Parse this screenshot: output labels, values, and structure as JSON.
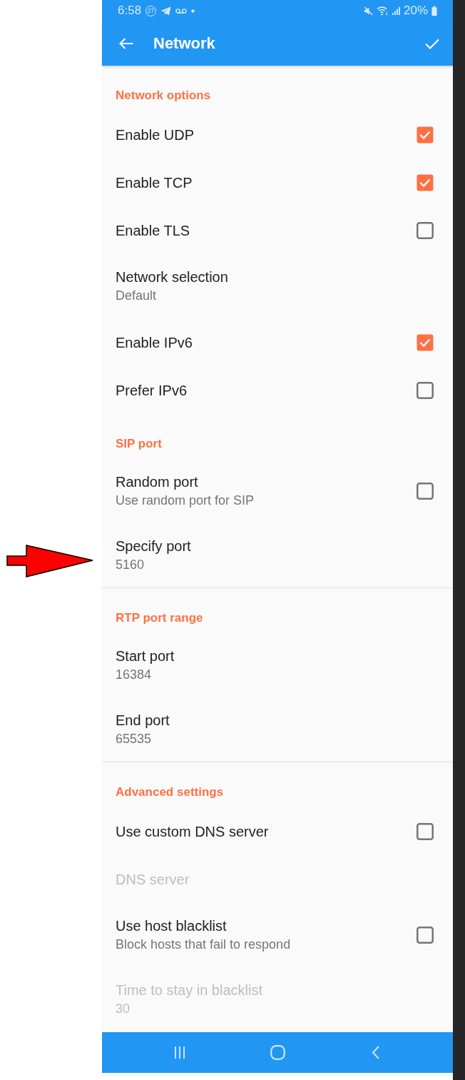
{
  "status_bar": {
    "time": "6:58",
    "notification_count": "27",
    "battery": "20%"
  },
  "app_bar": {
    "title": "Network"
  },
  "sections": [
    {
      "title": "Network options",
      "divider": false,
      "items": [
        {
          "kind": "checkbox",
          "title": "Enable UDP",
          "checked": true,
          "disabled": false
        },
        {
          "kind": "checkbox",
          "title": "Enable TCP",
          "checked": true,
          "disabled": false
        },
        {
          "kind": "checkbox",
          "title": "Enable TLS",
          "checked": false,
          "disabled": false
        },
        {
          "kind": "text",
          "title": "Network selection",
          "summary": "Default",
          "disabled": false
        },
        {
          "kind": "checkbox",
          "title": "Enable IPv6",
          "checked": true,
          "disabled": false
        },
        {
          "kind": "checkbox",
          "title": "Prefer IPv6",
          "checked": false,
          "disabled": false
        }
      ]
    },
    {
      "title": "SIP port",
      "divider": false,
      "items": [
        {
          "kind": "checkbox",
          "title": "Random port",
          "summary": "Use random port for SIP",
          "checked": false,
          "disabled": false
        },
        {
          "kind": "text",
          "title": "Specify port",
          "summary": "5160",
          "disabled": false
        }
      ]
    },
    {
      "title": "RTP port range",
      "divider": true,
      "items": [
        {
          "kind": "text",
          "title": "Start port",
          "summary": "16384",
          "disabled": false
        },
        {
          "kind": "text",
          "title": "End port",
          "summary": "65535",
          "disabled": false
        }
      ]
    },
    {
      "title": "Advanced settings",
      "divider": true,
      "items": [
        {
          "kind": "checkbox",
          "title": "Use custom DNS server",
          "checked": false,
          "disabled": false
        },
        {
          "kind": "text",
          "title": "DNS server",
          "disabled": true
        },
        {
          "kind": "checkbox",
          "title": "Use host blacklist",
          "summary": "Block hosts that fail to respond",
          "checked": false,
          "disabled": false
        },
        {
          "kind": "text",
          "title": "Time to stay in blacklist",
          "summary": "30",
          "disabled": true
        }
      ]
    }
  ]
}
